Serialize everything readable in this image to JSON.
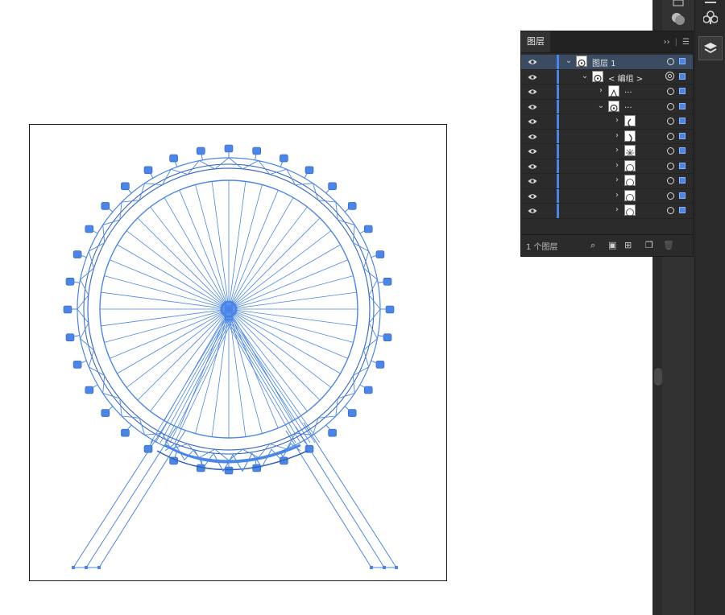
{
  "layers_panel": {
    "tab_label": "图层",
    "footer_count": "1 个图层",
    "rows": [
      {
        "name": "图层 1",
        "selected": true,
        "thumb": "ferris-wheel"
      },
      {
        "name": "< 编组 >",
        "thumb": "ferris-wheel"
      },
      {
        "name": "...",
        "thumb": "legs"
      },
      {
        "name": "...",
        "thumb": "ferris-wheel"
      },
      {
        "name": "",
        "thumb": "arc-left"
      },
      {
        "name": "",
        "thumb": "arc-right"
      },
      {
        "name": "",
        "thumb": "spokes"
      },
      {
        "name": "",
        "thumb": "ring"
      },
      {
        "name": "",
        "thumb": "ring"
      },
      {
        "name": "",
        "thumb": "ring"
      },
      {
        "name": "",
        "thumb": "ring"
      }
    ]
  },
  "colors": {
    "selection_blue": "#4a86e8",
    "panel_bg": "#2b2b2b",
    "selected_row": "#3a4b62"
  },
  "icons": {
    "panel_toolbar": [
      "search-icon",
      "collect-export-icon",
      "make-clipping-mask-icon",
      "new-layer-icon",
      "delete-icon"
    ],
    "dock": [
      "properties-icon",
      "appearance-icon",
      "symbols-icon",
      "layers-icon"
    ]
  }
}
